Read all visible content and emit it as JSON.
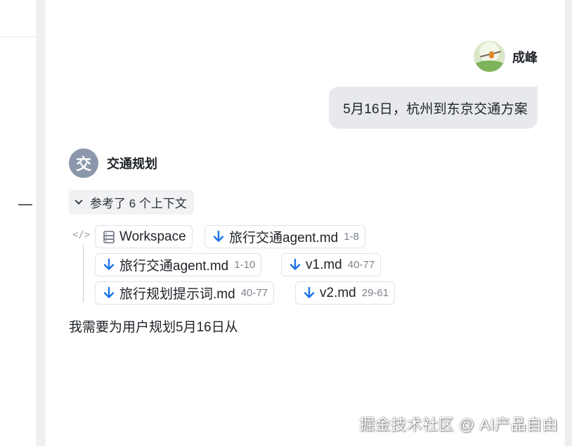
{
  "user": {
    "name": "成峰",
    "message": "5月16日，杭州到东京交通方案"
  },
  "agent": {
    "avatar_char": "交",
    "name": "交通规划",
    "context_toggle": "参考了 6 个上下文",
    "code_icon": "</>",
    "context_files": [
      {
        "icon": "database-icon",
        "name": "Workspace",
        "range": ""
      },
      {
        "icon": "download-icon",
        "name": "旅行交通agent.md",
        "range": "1-8"
      },
      {
        "icon": "download-icon",
        "name": "旅行交通agent.md",
        "range": "1-10"
      },
      {
        "icon": "download-icon",
        "name": "v1.md",
        "range": "40-77"
      },
      {
        "icon": "download-icon",
        "name": "旅行规划提示词.md",
        "range": "40-77"
      },
      {
        "icon": "download-icon",
        "name": "v2.md",
        "range": "29-61"
      }
    ],
    "answer": "我需要为用户规划5月16日从"
  },
  "watermark": "掘金技术社区 @ AI产品自由",
  "colors": {
    "accent_blue": "#1a73e8",
    "agent_avatar": "#8c97ab",
    "bubble": "#e7e9ed"
  }
}
